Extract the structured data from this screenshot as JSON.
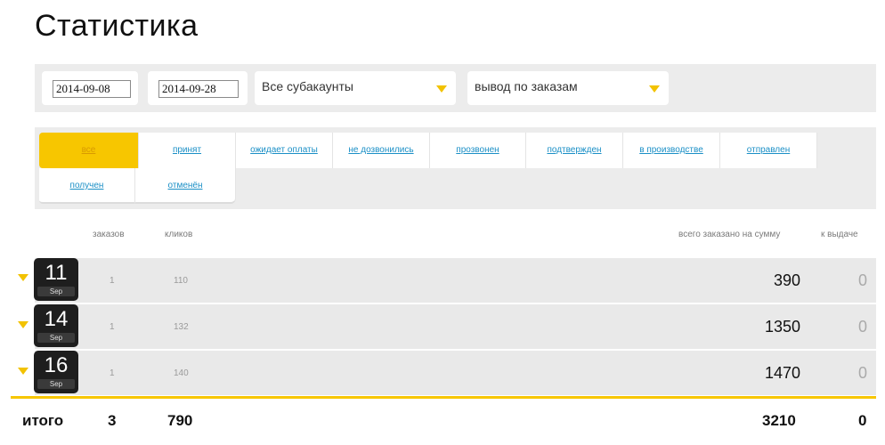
{
  "page": {
    "title": "Статистика"
  },
  "filters": {
    "date_from": "2014-09-08",
    "date_to": "2014-09-28",
    "subaccount": "Все субакаунты",
    "output": "вывод по заказам"
  },
  "tabs": [
    {
      "label": "все",
      "active": true
    },
    {
      "label": "принят"
    },
    {
      "label": "ожидает оплаты"
    },
    {
      "label": "не дозвонились"
    },
    {
      "label": "прозвонен"
    },
    {
      "label": "подтвержден"
    },
    {
      "label": "в производстве"
    },
    {
      "label": "отправлен"
    },
    {
      "label": "получен"
    },
    {
      "label": "отменён"
    }
  ],
  "columns": {
    "orders": "заказов",
    "clicks": "кликов",
    "total_sum": "всего заказано на сумму",
    "payout": "к выдаче"
  },
  "rows": [
    {
      "day": "11",
      "month": "Sep",
      "orders": "1",
      "clicks": "110",
      "sum": "390",
      "payout": "0"
    },
    {
      "day": "14",
      "month": "Sep",
      "orders": "1",
      "clicks": "132",
      "sum": "1350",
      "payout": "0"
    },
    {
      "day": "16",
      "month": "Sep",
      "orders": "1",
      "clicks": "140",
      "sum": "1470",
      "payout": "0"
    }
  ],
  "totals": {
    "label": "итого",
    "orders": "3",
    "clicks": "790",
    "sum": "3210",
    "payout": "0"
  },
  "colors": {
    "accent": "#f7c600",
    "link": "#1a8fc6",
    "row_bg": "#e9e9e9"
  }
}
